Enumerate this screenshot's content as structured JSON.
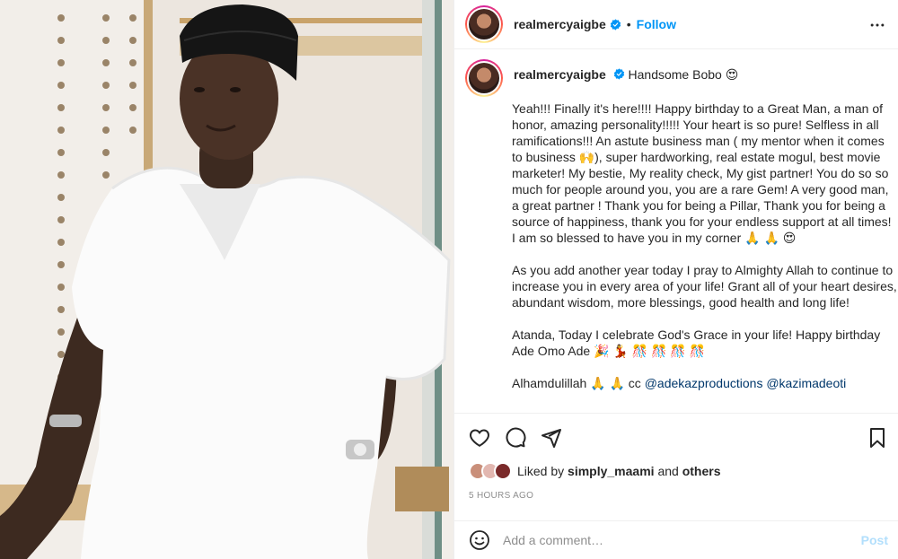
{
  "header": {
    "username": "realmercyaigbe",
    "separator": "•",
    "follow_label": "Follow",
    "more_icon": "more-options-icon"
  },
  "caption": {
    "username": "realmercyaigbe",
    "title_text": "Handsome Bobo 😍",
    "paragraphs": [
      "Yeah!!! Finally it's here!!!! Happy birthday to a Great Man, a man of honor, amazing personality!!!!! Your heart is so pure! Selfless in all ramifications!!! An astute business man ( my mentor when it comes to business 🙌), super hardworking, real estate mogul, best movie marketer! My bestie, My reality check, My gist partner! You do so so much for people around you, you are a rare Gem! A very good man, a great partner ! Thank you for being a Pillar, Thank you for being a source of happiness, thank you for your endless support at all times! I am so blessed to have you in my corner 🙏 🙏 😍",
      "As you add another year today I pray to Almighty Allah to continue to increase you in every area of your life! Grant all of your heart desires, abundant wisdom, more blessings, good health and long life!",
      "Atanda, Today I celebrate God's Grace in your life! Happy birthday Ade Omo Ade 🎉 💃 🎊 🎊 🎊 🎊",
      "Alhamdulillah 🙏 🙏 cc"
    ],
    "mentions": [
      "@adekazproductions",
      "@kazimadeoti"
    ]
  },
  "actions": {
    "like_icon": "heart-icon",
    "comment_icon": "comment-icon",
    "share_icon": "share-icon",
    "save_icon": "bookmark-icon"
  },
  "likes": {
    "prefix": "Liked by",
    "user": "simply_maami",
    "and": "and",
    "others": "others"
  },
  "timestamp": "5 HOURS AGO",
  "comment_box": {
    "placeholder": "Add a comment…",
    "post_label": "Post",
    "emoji_icon": "emoji-icon"
  },
  "colors": {
    "accent": "#0095f6",
    "mention": "#00376b",
    "post_disabled": "#b2dffc",
    "muted": "#8e8e8e"
  }
}
